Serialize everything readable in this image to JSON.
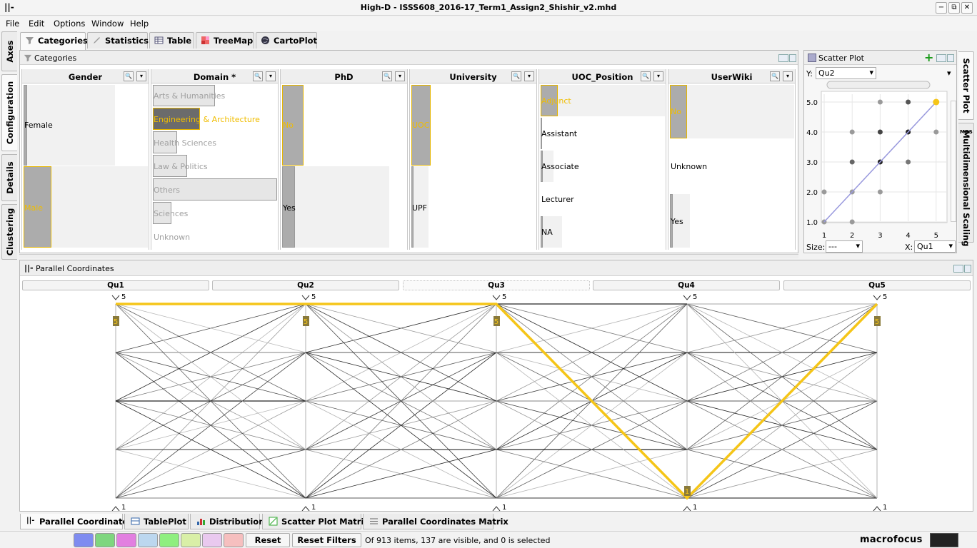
{
  "window": {
    "title": "High-D - ISSS608_2016-17_Term1_Assign2_Shishir_v2.mhd",
    "logo": "||-",
    "min": "−",
    "max": "⧉",
    "close": "✕"
  },
  "menu": [
    "File",
    "Edit",
    "Options",
    "Window",
    "Help"
  ],
  "top_tabs": [
    "Categories",
    "Statistics",
    "Table",
    "TreeMap",
    "CartoPlot"
  ],
  "left_tabs": [
    "Axes",
    "Configuration",
    "Details",
    "Clustering"
  ],
  "right_tabs": [
    "Scatter Plot",
    "Multidimensional Scaling"
  ],
  "right_tab_mds_icon": "MDS",
  "categories_panel": {
    "title": "Categories"
  },
  "columns": [
    {
      "name": "Gender",
      "items": [
        "Female",
        "Male"
      ]
    },
    {
      "name": "Domain *",
      "items": [
        "Arts & Humanities",
        "Engineering & Architecture",
        "Health Sciences",
        "Law & Politics",
        "Others",
        "Sciences",
        "Unknown"
      ]
    },
    {
      "name": "PhD",
      "items": [
        "No",
        "Yes"
      ]
    },
    {
      "name": "University",
      "items": [
        "UOC",
        "UPF"
      ]
    },
    {
      "name": "UOC_Position",
      "items": [
        "Adjunct",
        "Assistant",
        "Associate",
        "Lecturer",
        "NA"
      ]
    },
    {
      "name": "UserWiki",
      "items": [
        "No",
        "Unknown",
        "Yes"
      ]
    }
  ],
  "scatter": {
    "title": "Scatter Plot",
    "y_label": "Y:",
    "y_value": "Qu2",
    "size_label": "Size:",
    "size_value": "---",
    "x_label": "X:",
    "x_value": "Qu1",
    "x_ticks": [
      "1",
      "2",
      "3",
      "4",
      "5"
    ],
    "y_ticks": [
      "5.0",
      "4.0",
      "3.0",
      "2.0",
      "1.0"
    ]
  },
  "parallel": {
    "title": "Parallel Coordinates",
    "axes": [
      "Qu1",
      "Qu2",
      "Qu3",
      "Qu4",
      "Qu5"
    ],
    "top_value": "5",
    "bottom_value": "1",
    "selected_values": [
      "5",
      "5",
      "5",
      "1",
      "5"
    ]
  },
  "bottom_tabs": [
    "Parallel Coordinates",
    "TablePlot",
    "Distributions",
    "Scatter Plot Matrix",
    "Parallel Coordinates Matrix"
  ],
  "status": {
    "reset": "Reset",
    "reset_filters": "Reset Filters",
    "message": "Of 913 items, 137 are visible, and 0 is selected",
    "brand": "macrofocus"
  },
  "colors": {
    "highlight": "#f5c518",
    "swatches": [
      "#7f8cf0",
      "#7fd67f",
      "#e27fe0",
      "#bcd7ef",
      "#8fef7f",
      "#d9efa7",
      "#e9c9ef",
      "#f6bfbf"
    ]
  }
}
